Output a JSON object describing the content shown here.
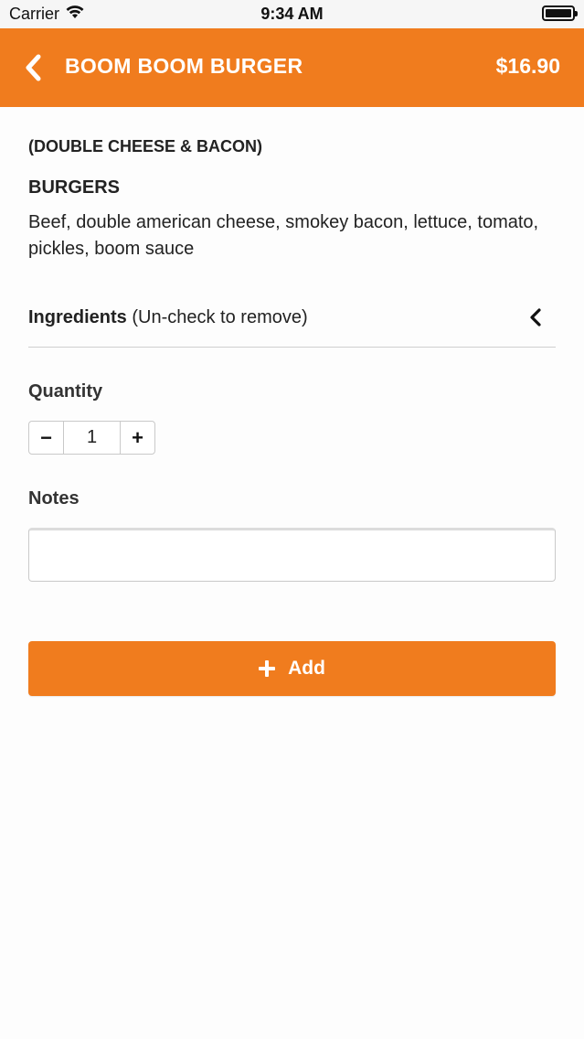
{
  "status_bar": {
    "carrier": "Carrier",
    "time": "9:34 AM",
    "wifi_icon": "wifi-icon",
    "battery_icon": "battery-icon"
  },
  "header": {
    "back_icon": "chevron-left-icon",
    "title": "BOOM BOOM BURGER",
    "price": "$16.90"
  },
  "item": {
    "subtitle": "(DOUBLE CHEESE & BACON)",
    "category": "BURGERS",
    "description": "Beef, double american cheese, smokey bacon, lettuce, tomato, pickles, boom sauce"
  },
  "ingredients": {
    "label": "Ingredients",
    "hint": " (Un-check to remove)",
    "icon": "chevron-left-icon"
  },
  "quantity": {
    "label": "Quantity",
    "minus": "−",
    "value": "1",
    "plus": "+"
  },
  "notes": {
    "label": "Notes",
    "value": "",
    "placeholder": ""
  },
  "actions": {
    "add_label": "Add",
    "add_icon": "plus-icon"
  },
  "colors": {
    "brand": "#f07c1e",
    "background": "#fdfdfd"
  }
}
